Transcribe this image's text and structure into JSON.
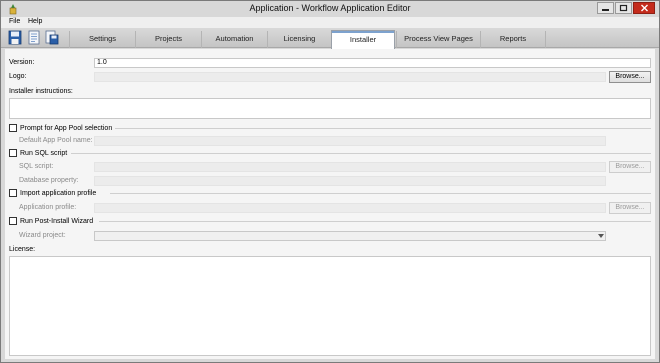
{
  "window": {
    "title": "Application - Workflow Application Editor"
  },
  "menu": {
    "file": "File",
    "help": "Help"
  },
  "toolbar": {
    "icons": [
      "save-icon",
      "open-icon",
      "save-as-icon"
    ]
  },
  "tabs": [
    {
      "label": "Settings",
      "active": false
    },
    {
      "label": "Projects",
      "active": false
    },
    {
      "label": "Automation",
      "active": false
    },
    {
      "label": "Licensing",
      "active": false
    },
    {
      "label": "Installer",
      "active": true
    },
    {
      "label": "Process View Pages",
      "active": false
    },
    {
      "label": "Reports",
      "active": false
    }
  ],
  "form": {
    "version_label": "Version:",
    "version_value": "1.0",
    "logo_label": "Logo:",
    "logo_browse": "Browse...",
    "instructions_label": "Installer instructions:",
    "app_pool": {
      "checkbox_label": "Prompt for App Pool selection",
      "checked": false,
      "default_name_label": "Default App Pool name:"
    },
    "sql": {
      "checkbox_label": "Run SQL script",
      "checked": false,
      "script_label": "SQL script:",
      "browse": "Browse...",
      "db_property_label": "Database property:"
    },
    "profile": {
      "checkbox_label": "Import application profile",
      "checked": false,
      "profile_label": "Application profile:",
      "browse": "Browse..."
    },
    "wizard": {
      "checkbox_label": "Run Post-Install Wizard",
      "checked": false,
      "project_label": "Wizard project:"
    },
    "license_label": "License:"
  },
  "colors": {
    "active_tab_accent": "#7da2ce",
    "close_button": "#c42b1c"
  }
}
